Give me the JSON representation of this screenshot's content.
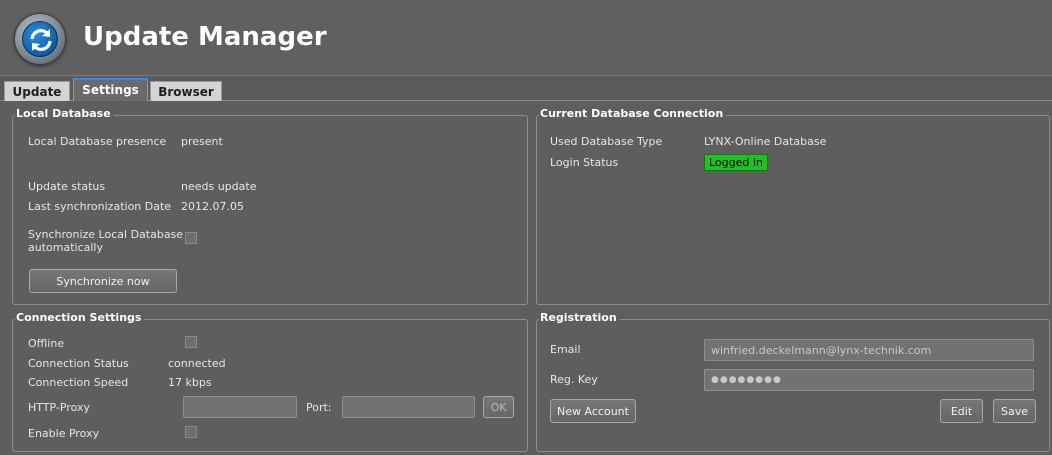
{
  "app": {
    "title": "Update Manager"
  },
  "tabs": [
    {
      "label": "Update"
    },
    {
      "label": "Settings",
      "active": true
    },
    {
      "label": "Browser"
    }
  ],
  "local_database": {
    "title": "Local Database",
    "presence_label": "Local Database presence",
    "presence_value": "present",
    "update_status_label": "Update status",
    "update_status_value": "needs update",
    "last_sync_label": "Last synchronization Date",
    "last_sync_value": "2012.07.05",
    "auto_sync_label_line1": "Synchronize Local Database",
    "auto_sync_label_line2": "automatically",
    "auto_sync_checked": false,
    "sync_now_label": "Synchronize now"
  },
  "current_connection": {
    "title": "Current Database Connection",
    "db_type_label": "Used Database Type",
    "db_type_value": "LYNX-Online Database",
    "login_status_label": "Login Status",
    "login_status_value": "Logged in",
    "login_status_color": "#1ec21e"
  },
  "connection_settings": {
    "title": "Connection Settings",
    "offline_label": "Offline",
    "offline_checked": false,
    "status_label": "Connection Status",
    "status_value": "connected",
    "speed_label": "Connection Speed",
    "speed_value": "17 kbps",
    "proxy_label": "HTTP-Proxy",
    "proxy_value": "",
    "port_label": "Port:",
    "port_value": "",
    "ok_label": "OK",
    "enable_proxy_label": "Enable Proxy",
    "enable_proxy_checked": false
  },
  "registration": {
    "title": "Registration",
    "email_label": "Email",
    "email_value": "winfried.deckelmann@lynx-technik.com",
    "key_label": "Reg. Key",
    "key_value": "●●●●●●●●",
    "new_account_label": "New Account",
    "edit_label": "Edit",
    "save_label": "Save"
  }
}
